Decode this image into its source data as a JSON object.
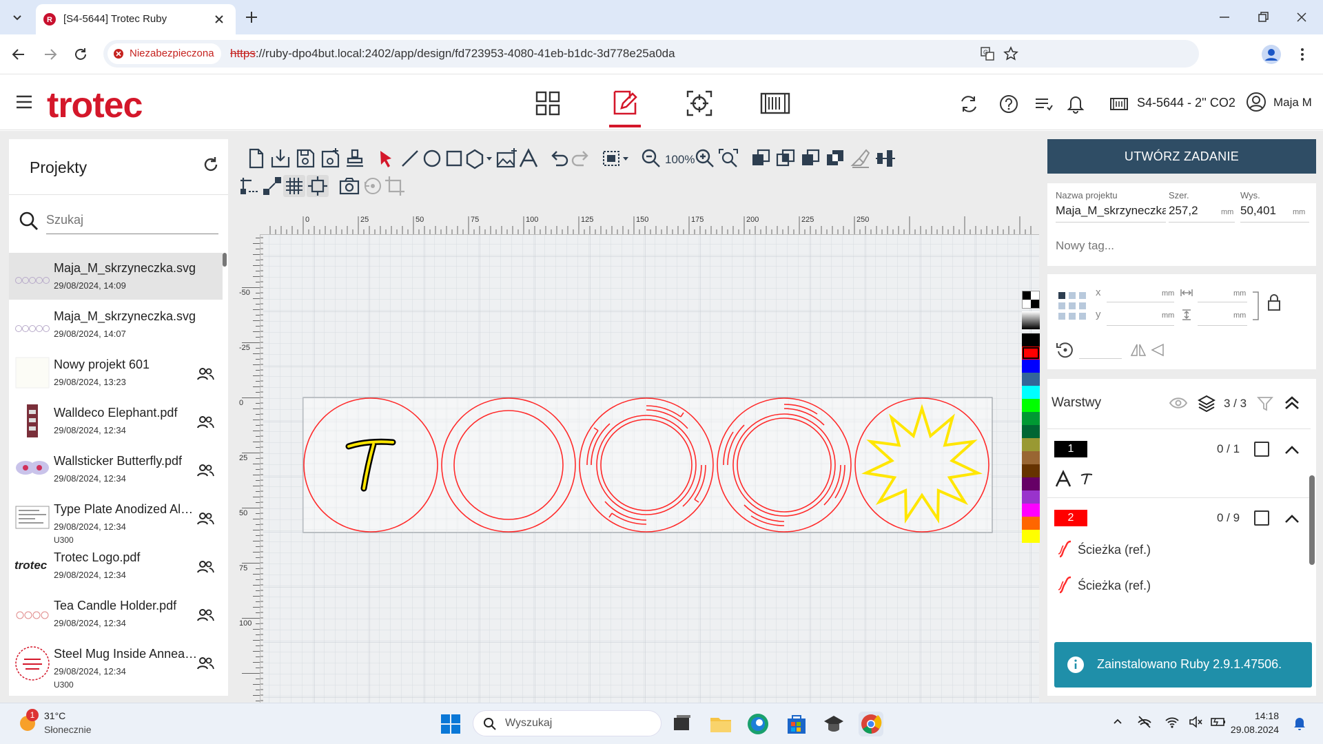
{
  "browser": {
    "tab_title": "[S4-5644] Trotec Ruby",
    "not_secure": "Niezabezpieczona",
    "url_scheme": "https",
    "url_rest": "://ruby-dpo4but.local:2402/app/design/fd723953-4080-41eb-b1dc-3d778e25a0da"
  },
  "header": {
    "logo": "trotec",
    "machine": "S4-5644 - 2'' CO2",
    "user": "Maja M"
  },
  "projects": {
    "title": "Projekty",
    "search_placeholder": "Szukaj",
    "items": [
      {
        "name": "Maja_M_skrzyneczka.svg",
        "date": "29/08/2024, 14:09",
        "machine": "",
        "shared": false
      },
      {
        "name": "Maja_M_skrzyneczka.svg",
        "date": "29/08/2024, 14:07",
        "machine": "",
        "shared": false
      },
      {
        "name": "Nowy projekt 601",
        "date": "29/08/2024, 13:23",
        "machine": "",
        "shared": true
      },
      {
        "name": "Walldeco Elephant.pdf",
        "date": "29/08/2024, 12:34",
        "machine": "",
        "shared": true
      },
      {
        "name": "Wallsticker Butterfly.pdf",
        "date": "29/08/2024, 12:34",
        "machine": "",
        "shared": true
      },
      {
        "name": "Type Plate Anodized Aluminium",
        "date": "29/08/2024, 12:34",
        "machine": "U300",
        "shared": true
      },
      {
        "name": "Trotec Logo.pdf",
        "date": "29/08/2024, 12:34",
        "machine": "",
        "shared": true
      },
      {
        "name": "Tea Candle Holder.pdf",
        "date": "29/08/2024, 12:34",
        "machine": "",
        "shared": true
      },
      {
        "name": "Steel Mug Inside Annealing",
        "date": "29/08/2024, 12:34",
        "machine": "U300",
        "shared": true
      }
    ],
    "thumb_trotec": "trotec"
  },
  "toolbar": {
    "zoom": "100%"
  },
  "ruler": {
    "h_ticks": [
      "0",
      "25",
      "50",
      "75",
      "100",
      "125",
      "150",
      "175",
      "200",
      "225",
      "250"
    ],
    "v_ticks": [
      "-50",
      "-25",
      "0",
      "25",
      "50",
      "75",
      "100"
    ]
  },
  "palette": [
    "#000000",
    "#ff0000",
    "#0000ff",
    "#336699",
    "#00ffff",
    "#00ff00",
    "#009933",
    "#006633",
    "#999933",
    "#996633",
    "#663300",
    "#660066",
    "#9933cc",
    "#ff00ff",
    "#ff6600",
    "#ffff00"
  ],
  "right": {
    "create_job": "UTWÓRZ ZADANIE",
    "name_label": "Nazwa projektu",
    "name_value": "Maja_M_skrzyneczka",
    "width_label": "Szer.",
    "width_value": "257,2",
    "height_label": "Wys.",
    "height_value": "50,401",
    "unit": "mm",
    "tag_placeholder": "Nowy tag...",
    "x_label": "x",
    "y_label": "y",
    "layers_title": "Warstwy",
    "layers_count": "3 / 3",
    "layer1": {
      "num": "1",
      "count": "0 / 1",
      "color": "#000000"
    },
    "layer2": {
      "num": "2",
      "count": "0 / 9",
      "color": "#ff0000"
    },
    "path_label": "Ścieżka (ref.)"
  },
  "toast": "Zainstalowano Ruby 2.9.1.47506.",
  "taskbar": {
    "temp": "31°C",
    "weather": "Słonecznie",
    "badge": "1",
    "search": "Wyszukaj",
    "time": "14:18",
    "date": "29.08.2024"
  }
}
